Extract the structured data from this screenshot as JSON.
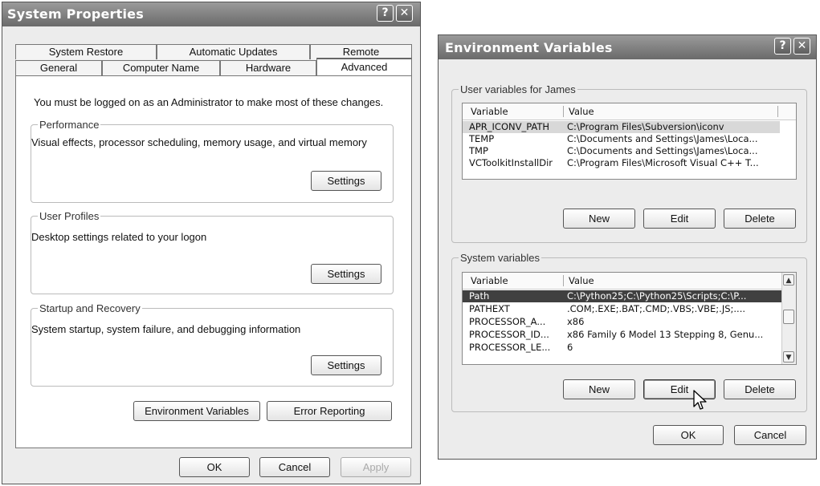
{
  "system_properties": {
    "title": "System Properties",
    "help_glyph": "?",
    "close_glyph": "✕",
    "tabs_back": [
      "System Restore",
      "Automatic Updates",
      "Remote"
    ],
    "tabs_front": [
      "General",
      "Computer Name",
      "Hardware",
      "Advanced"
    ],
    "active_tab": "Advanced",
    "admin_note": "You must be logged on as an Administrator to make most of these changes.",
    "performance": {
      "legend": "Performance",
      "description": "Visual effects, processor scheduling, memory usage, and virtual memory",
      "button": "Settings"
    },
    "user_profiles": {
      "legend": "User Profiles",
      "description": "Desktop settings related to your logon",
      "button": "Settings"
    },
    "startup_recovery": {
      "legend": "Startup and Recovery",
      "description": "System startup, system failure, and debugging information",
      "button": "Settings"
    },
    "env_vars_button": "Environment Variables",
    "error_reporting_button": "Error Reporting",
    "ok_button": "OK",
    "cancel_button": "Cancel",
    "apply_button": "Apply"
  },
  "environment_variables": {
    "title": "Environment Variables",
    "help_glyph": "?",
    "close_glyph": "✕",
    "user_group": {
      "legend": "User variables for James",
      "columns": [
        "Variable",
        "Value"
      ],
      "rows": [
        {
          "variable": "APR_ICONV_PATH",
          "value": "C:\\Program Files\\Subversion\\iconv"
        },
        {
          "variable": "TEMP",
          "value": "C:\\Documents and Settings\\James\\Loca..."
        },
        {
          "variable": "TMP",
          "value": "C:\\Documents and Settings\\James\\Loca..."
        },
        {
          "variable": "VCToolkitInstallDir",
          "value": "C:\\Program Files\\Microsoft Visual C++ T..."
        }
      ],
      "selected_row": 0,
      "buttons": [
        "New",
        "Edit",
        "Delete"
      ]
    },
    "system_group": {
      "legend": "System variables",
      "columns": [
        "Variable",
        "Value"
      ],
      "rows": [
        {
          "variable": "Path",
          "value": "C:\\Python25;C:\\Python25\\Scripts;C:\\P..."
        },
        {
          "variable": "PATHEXT",
          "value": ".COM;.EXE;.BAT;.CMD;.VBS;.VBE;.JS;...."
        },
        {
          "variable": "PROCESSOR_A...",
          "value": "x86"
        },
        {
          "variable": "PROCESSOR_ID...",
          "value": "x86 Family 6 Model 13 Stepping 8, Genu..."
        },
        {
          "variable": "PROCESSOR_LE...",
          "value": "6"
        }
      ],
      "selected_row": 0,
      "buttons": [
        "New",
        "Edit",
        "Delete"
      ]
    },
    "ok_button": "OK",
    "cancel_button": "Cancel"
  },
  "icons": {
    "scroll_up": "▲",
    "scroll_down": "▼"
  },
  "colors": {
    "titlebar": "#7a7a7a",
    "selection_dark": "#404040",
    "selection_light": "#d8d8d8"
  }
}
